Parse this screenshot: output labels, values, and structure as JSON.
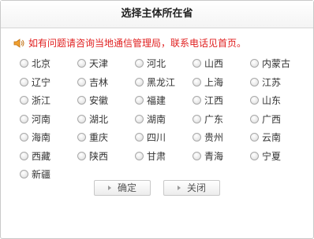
{
  "dialog": {
    "title": "选择主体所在省",
    "notice": "如有问题请咨询当地通信管理局，联系电话见首页。",
    "notice_icon": "speaker-icon",
    "notice_color": "#e02020"
  },
  "provinces": [
    "北京",
    "天津",
    "河北",
    "山西",
    "内蒙古",
    "辽宁",
    "吉林",
    "黑龙江",
    "上海",
    "江苏",
    "浙江",
    "安徽",
    "福建",
    "江西",
    "山东",
    "河南",
    "湖北",
    "湖南",
    "广东",
    "广西",
    "海南",
    "重庆",
    "四川",
    "贵州",
    "云南",
    "西藏",
    "陕西",
    "甘肃",
    "青海",
    "宁夏",
    "新疆"
  ],
  "buttons": {
    "confirm": "确定",
    "close": "关闭"
  }
}
